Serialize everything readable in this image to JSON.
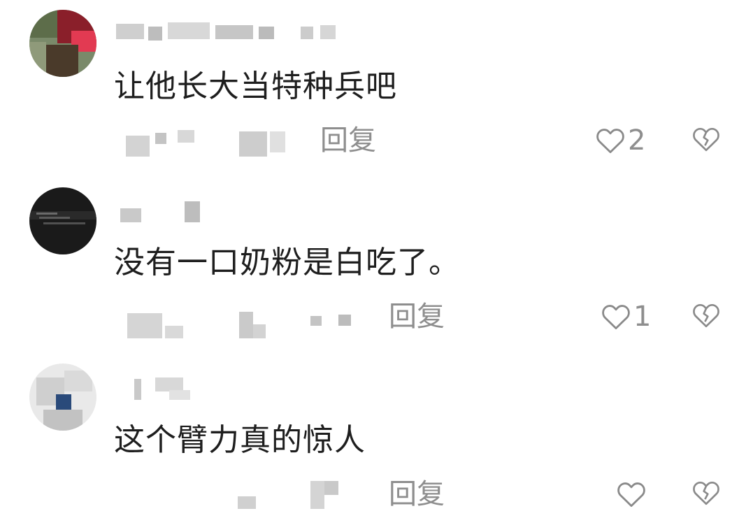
{
  "comments": [
    {
      "text": "让他长大当特种兵吧",
      "reply_label": "回复",
      "like_count": "2",
      "like_icon": "heart-outline-icon",
      "dislike_icon": "broken-heart-icon"
    },
    {
      "text": "没有一口奶粉是白吃了。",
      "reply_label": "回复",
      "like_count": "1",
      "like_icon": "heart-outline-icon",
      "dislike_icon": "broken-heart-icon"
    },
    {
      "text": "这个臂力真的惊人",
      "reply_label": "回复",
      "like_count": "",
      "like_icon": "heart-outline-icon",
      "dislike_icon": "broken-heart-icon"
    }
  ],
  "colors": {
    "text": "#1e1e1e",
    "muted": "#8e8e8e",
    "icon_stroke": "#8a8a8a"
  }
}
